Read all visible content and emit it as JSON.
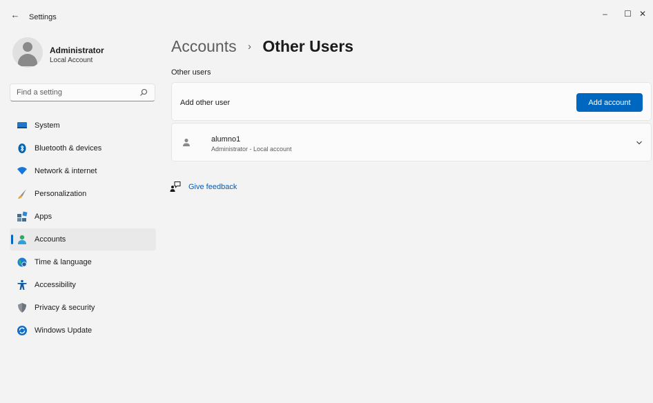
{
  "window": {
    "title": "Settings",
    "controls": {
      "minimize": "–",
      "maximize": "☐",
      "close": "✕"
    }
  },
  "profile": {
    "name": "Administrator",
    "subtitle": "Local Account"
  },
  "search": {
    "placeholder": "Find a setting"
  },
  "nav": {
    "items": [
      {
        "label": "System",
        "icon": "monitor-icon"
      },
      {
        "label": "Bluetooth & devices",
        "icon": "bluetooth-icon"
      },
      {
        "label": "Network & internet",
        "icon": "wifi-icon"
      },
      {
        "label": "Personalization",
        "icon": "brush-icon"
      },
      {
        "label": "Apps",
        "icon": "apps-icon"
      },
      {
        "label": "Accounts",
        "icon": "accounts-icon",
        "selected": true
      },
      {
        "label": "Time & language",
        "icon": "globe-clock-icon"
      },
      {
        "label": "Accessibility",
        "icon": "accessibility-icon"
      },
      {
        "label": "Privacy & security",
        "icon": "shield-icon"
      },
      {
        "label": "Windows Update",
        "icon": "update-icon"
      }
    ]
  },
  "breadcrumb": {
    "parent": "Accounts",
    "separator": "›",
    "current": "Other Users"
  },
  "section": {
    "label": "Other users"
  },
  "add_card": {
    "label": "Add other user",
    "button": "Add account"
  },
  "user_card": {
    "name": "alumno1",
    "subtitle": "Administrator - Local account"
  },
  "feedback": {
    "label": "Give feedback"
  },
  "colors": {
    "accent": "#0067c0",
    "background": "#f3f3f3",
    "card": "#fbfbfb"
  }
}
